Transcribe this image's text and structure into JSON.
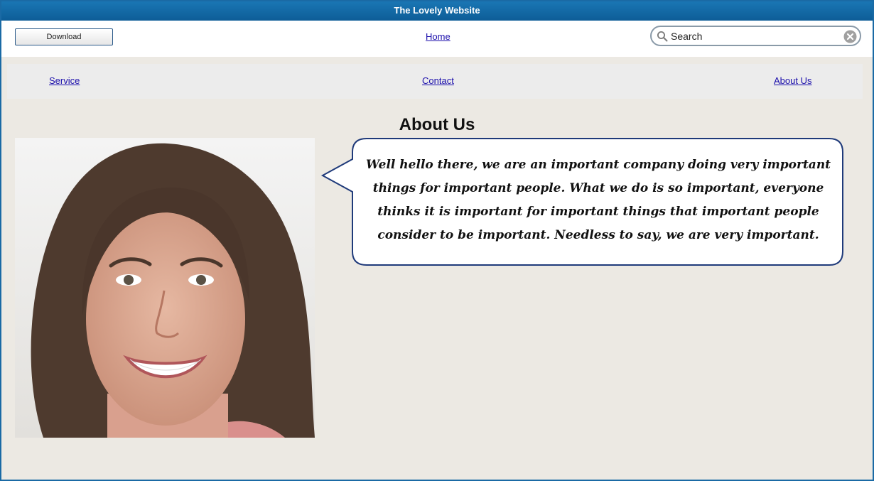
{
  "window": {
    "title": "The Lovely Website"
  },
  "toolbar": {
    "download_label": "Download",
    "home_label": "Home",
    "search": {
      "placeholder": "Search",
      "value": ""
    }
  },
  "nav": {
    "items": [
      {
        "label": "Service"
      },
      {
        "label": "Contact"
      },
      {
        "label": "About Us"
      }
    ]
  },
  "main": {
    "title": "About Us",
    "bubble_text": "Well hello there, we are an important company doing very important things for important people. What we do is so important, everyone thinks it is important for important things that important people consider to be important. Needless to say, we are very important.",
    "photo_alt": "Smiling woman with shoulder-length brown hair"
  },
  "colors": {
    "titlebar": "#0d5d97",
    "page_background": "#ece9e3",
    "nav_background": "#ececec",
    "link": "#1a0dab",
    "bubble_border": "#1f3a7a"
  },
  "icons": {
    "search": "magnifier-icon",
    "clear": "circle-x-icon"
  }
}
